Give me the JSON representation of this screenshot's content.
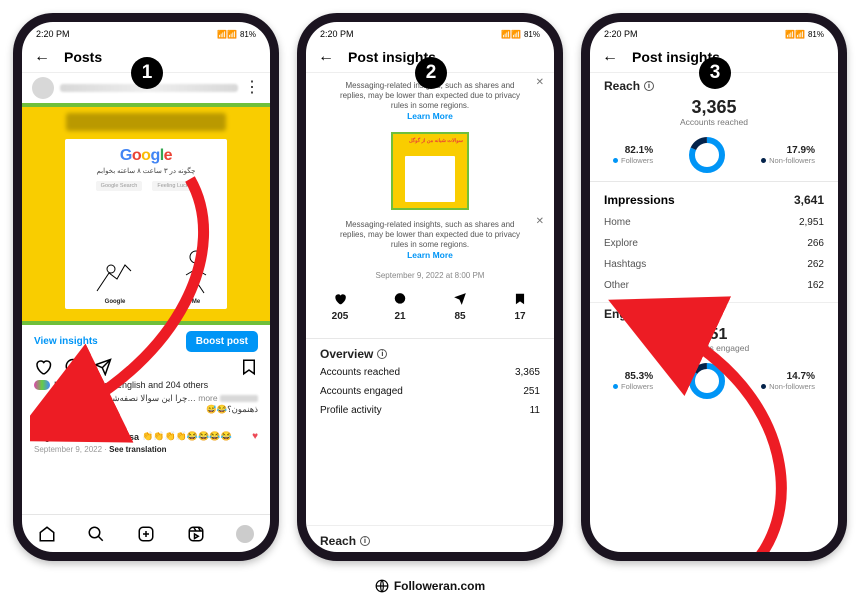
{
  "status": {
    "time": "2:20 PM",
    "battery": "81%",
    "icons": "◀ ⋯ ▪"
  },
  "numbers": [
    "1",
    "2",
    "3"
  ],
  "brand": "Followeran.com",
  "p1": {
    "title": "Posts",
    "view_insights": "View insights",
    "boost": "Boost post",
    "google_sub": "چگونه در ۳ ساعت ۸ ساعته بخوابم",
    "gbtn1": "Google Search",
    "gbtn2": "Feeling Lucky",
    "fig_g": "Google",
    "fig_me": "Me",
    "liked": "Liked by asana.english and 204 others",
    "caption_more": " more ",
    "caption": "…چرا این سوالا نصفه‌شب تازه میاد به ذهنمون؟😂😅",
    "view_comments": "View all 21 comments",
    "commuser": "english_learning_mahsa",
    "emojis": "👏👏👏👏😂😂😂😂",
    "date": "September 9, 2022",
    "see_trans": "See translation"
  },
  "p2": {
    "title": "Post insights",
    "msg": "Messaging-related insights, such as shares and replies, may be lower than expected due to privacy rules in some regions.",
    "learn": "Learn More",
    "thumb_title": "سوالات شبانه من از گوگل",
    "posted": "September 9, 2022 at 8:00 PM",
    "stats": {
      "likes": "205",
      "comments": "21",
      "shares": "85",
      "saves": "17"
    },
    "overview": "Overview",
    "rows": [
      {
        "k": "Accounts reached",
        "v": "3,365"
      },
      {
        "k": "Accounts engaged",
        "v": "251"
      },
      {
        "k": "Profile activity",
        "v": "11"
      }
    ],
    "reach": "Reach"
  },
  "p3": {
    "title": "Post insights",
    "reach": "Reach",
    "reached_n": "3,365",
    "reached_l": "Accounts reached",
    "split": {
      "f": "82.1%",
      "fl": "Followers",
      "nf": "17.9%",
      "nfl": "Non-followers"
    },
    "imp": "Impressions",
    "imp_v": "3,641",
    "imp_rows": [
      {
        "k": "Home",
        "v": "2,951"
      },
      {
        "k": "Explore",
        "v": "266"
      },
      {
        "k": "Hashtags",
        "v": "262"
      },
      {
        "k": "Other",
        "v": "162"
      }
    ],
    "eng": "Engagement",
    "eng_n": "251",
    "eng_l": "Accounts engaged",
    "esplit": {
      "f": "85.3%",
      "fl": "Followers",
      "nf": "14.7%",
      "nfl": "Non-followers"
    }
  }
}
